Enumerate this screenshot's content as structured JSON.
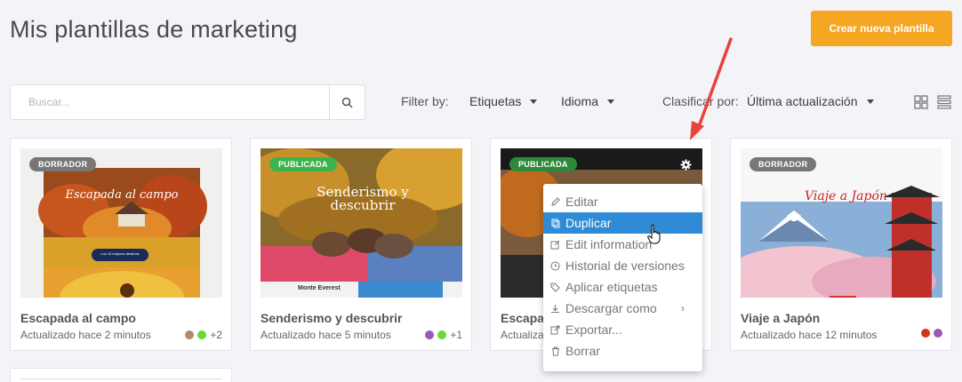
{
  "header": {
    "title": "Mis plantillas de marketing",
    "create_button": "Crear nueva plantilla"
  },
  "search": {
    "placeholder": "Buscar..."
  },
  "filters": {
    "filter_by_label": "Filter by:",
    "tags_dropdown": "Etiquetas",
    "language_dropdown": "Idioma",
    "sort_label": "Clasificar por:",
    "sort_value": "Última actualización"
  },
  "cards": [
    {
      "badge": "BORRADOR",
      "thumb_text": "Escapada al campo",
      "thumb_button": "Los 10 mejores destinos",
      "title": "Escapada al campo",
      "updated": "Actualizado hace 2 minutos",
      "dot_colors": [
        "#b5866a",
        "#66dd33"
      ],
      "extra": "+2"
    },
    {
      "badge": "PUBLICADA",
      "thumb_text": "Senderismo y descubrir",
      "thumb_caption": "Monte Everest",
      "title": "Senderismo y descubrir",
      "updated": "Actualizado hace 5 minutos",
      "dot_colors": [
        "#9b59b6",
        "#66dd33"
      ],
      "extra": "+1"
    },
    {
      "badge": "PUBLICADA",
      "title": "Escapa",
      "updated": "Actualiza"
    },
    {
      "badge": "BORRADOR",
      "thumb_text": "Viaje a Japón",
      "title": "Viaje a Japón",
      "updated": "Actualizado hace 12 minutos",
      "dot_colors": [
        "#d0341c",
        "#9b59b6"
      ]
    }
  ],
  "context_menu": {
    "items": [
      {
        "label": "Editar",
        "icon": "pencil-icon"
      },
      {
        "label": "Duplicar",
        "icon": "copy-icon",
        "active": true
      },
      {
        "label": "Edit information",
        "icon": "edit-box-icon"
      },
      {
        "label": "Historial de versiones",
        "icon": "clock-icon"
      },
      {
        "label": "Aplicar etiquetas",
        "icon": "tag-icon"
      },
      {
        "label": "Descargar como",
        "icon": "download-icon",
        "submenu": true
      },
      {
        "label": "Exportar...",
        "icon": "export-icon"
      },
      {
        "label": "Borrar",
        "icon": "trash-icon"
      }
    ]
  },
  "colors": {
    "accent": "#f5a623",
    "published": "#3cb44b",
    "draft": "#777777",
    "menu_active": "#2f8bd6",
    "annotation_arrow": "#e8423d"
  }
}
